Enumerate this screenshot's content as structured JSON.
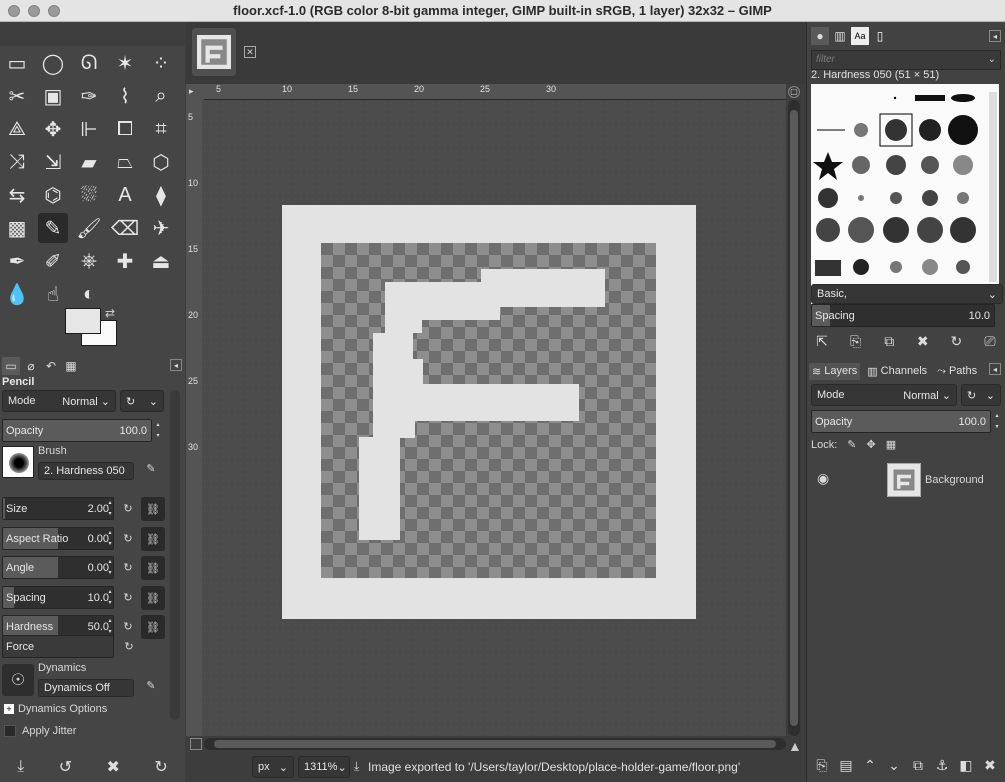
{
  "window": {
    "title": "floor.xcf-1.0 (RGB color 8-bit gamma integer, GIMP built-in sRGB, 1 layer) 32x32 – GIMP"
  },
  "toolbox": {
    "tools": [
      "rect-select-icon",
      "ellipse-select-icon",
      "free-select-icon",
      "fuzzy-select-icon",
      "color-select-icon",
      "scissors-select-icon",
      "foreground-select-icon",
      "paths-icon",
      "color-picker-icon",
      "zoom-icon",
      "measure-icon",
      "move-icon",
      "align-icon",
      "crop-icon",
      "unified-transform-icon",
      "warp-icon",
      "handle-transform-icon",
      "shear-icon",
      "perspective-icon",
      "3d-transform-icon",
      "flip-icon",
      "cage-icon",
      "bucket-fill-icon",
      "text-icon",
      "blend-icon",
      "gradient-icon",
      "pencil-icon",
      "paintbrush-icon",
      "eraser-icon",
      "airbrush-icon",
      "ink-icon",
      "mypaint-brush-icon",
      "clone-icon",
      "heal-icon",
      "perspective-clone-icon",
      "blur-icon",
      "smudge-icon",
      "dodge-burn-icon"
    ],
    "active_tool_index": 26,
    "fg_color": "#e6e6e6",
    "bg_color": "#fafafa"
  },
  "tool_options": {
    "title": "Pencil",
    "mode_label": "Mode",
    "mode_value": "Normal",
    "opacity_label": "Opacity",
    "opacity_value": "100.0",
    "brush_label": "Brush",
    "brush_value": "2. Hardness 050",
    "size_label": "Size",
    "size_value": "2.00",
    "size_fill": 0.02,
    "aspect_label": "Aspect Ratio",
    "aspect_value": "0.00",
    "aspect_fill": 0.5,
    "angle_label": "Angle",
    "angle_value": "0.00",
    "angle_fill": 0.5,
    "spacing_label": "Spacing",
    "spacing_value": "10.0",
    "spacing_fill": 0.1,
    "hardness_label": "Hardness",
    "hardness_value": "50.0",
    "hardness_fill": 0.5,
    "force_label": "Force",
    "dynamics_label": "Dynamics",
    "dynamics_value": "Dynamics Off",
    "dynamics_options_label": "Dynamics Options",
    "apply_jitter_label": "Apply Jitter"
  },
  "canvas": {
    "ruler_ticks": [
      "5",
      "10",
      "15",
      "20",
      "25",
      "30"
    ],
    "vruler_ticks": [
      "5",
      "10",
      "15",
      "20",
      "25",
      "30"
    ],
    "unit": "px",
    "zoom": "1311%",
    "status": "Image exported to '/Users/taylor/Desktop/place-holder-game/floor.png'"
  },
  "brushes": {
    "filter_placeholder": "filter",
    "selected_name": "2. Hardness 050 (51 × 51)",
    "tag": "Basic,",
    "spacing_label": "Spacing",
    "spacing_value": "10.0"
  },
  "layers": {
    "tabs": [
      "Layers",
      "Channels",
      "Paths"
    ],
    "mode_label": "Mode",
    "mode_value": "Normal",
    "opacity_label": "Opacity",
    "opacity_value": "100.0",
    "lock_label": "Lock:",
    "layer_name": "Background"
  }
}
